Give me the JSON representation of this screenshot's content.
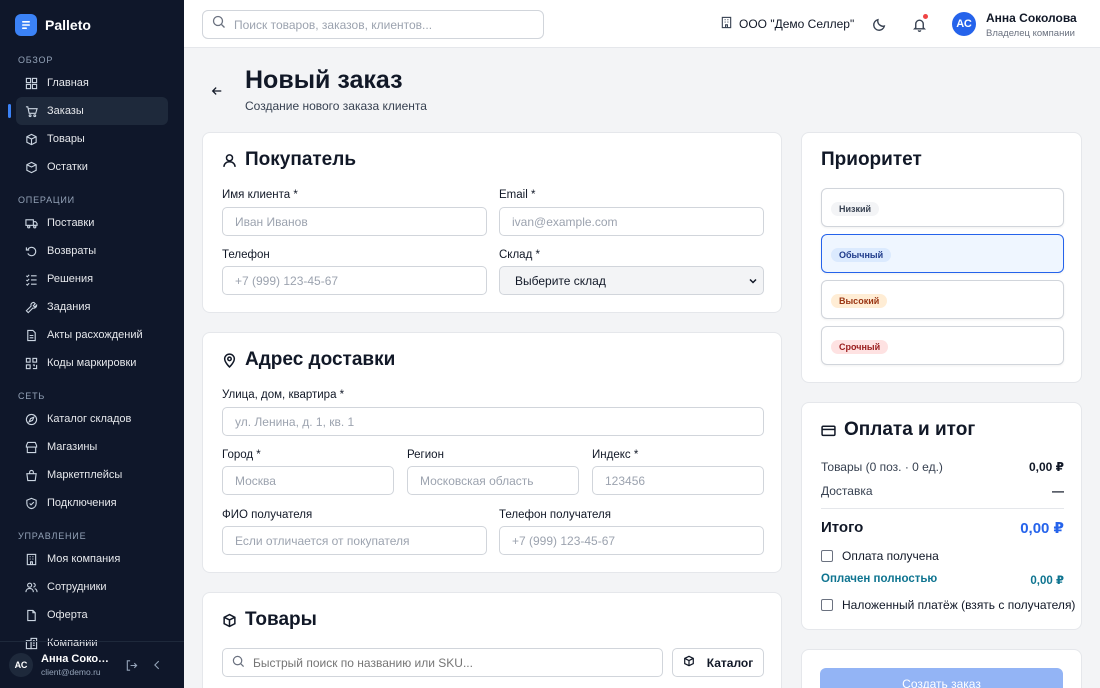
{
  "app": {
    "name": "Palleto"
  },
  "sidebar": {
    "sections": [
      {
        "title": "Обзор",
        "items": [
          {
            "label": "Главная",
            "icon": "grid-icon"
          },
          {
            "label": "Заказы",
            "icon": "cart-icon",
            "active": true
          },
          {
            "label": "Товары",
            "icon": "box-icon"
          },
          {
            "label": "Остатки",
            "icon": "stack-icon"
          }
        ]
      },
      {
        "title": "Операции",
        "items": [
          {
            "label": "Поставки",
            "icon": "truck-icon"
          },
          {
            "label": "Возвраты",
            "icon": "return-icon"
          },
          {
            "label": "Решения",
            "icon": "checklist-icon"
          },
          {
            "label": "Задания",
            "icon": "wrench-icon"
          },
          {
            "label": "Акты расхождений",
            "icon": "document-icon"
          },
          {
            "label": "Коды маркировки",
            "icon": "qr-icon"
          }
        ]
      },
      {
        "title": "Сеть",
        "items": [
          {
            "label": "Каталог складов",
            "icon": "compass-icon"
          },
          {
            "label": "Магазины",
            "icon": "store-icon"
          },
          {
            "label": "Маркетплейсы",
            "icon": "marketplace-icon"
          },
          {
            "label": "Подключения",
            "icon": "shield-icon"
          }
        ]
      },
      {
        "title": "Управление",
        "items": [
          {
            "label": "Моя компания",
            "icon": "building-icon"
          },
          {
            "label": "Сотрудники",
            "icon": "users-icon"
          },
          {
            "label": "Оферта",
            "icon": "file-icon"
          },
          {
            "label": "Компании",
            "icon": "buildings-icon"
          }
        ]
      }
    ],
    "user": {
      "initials": "АС",
      "name": "Анна Соколова",
      "email": "client@demo.ru"
    }
  },
  "topbar": {
    "search_placeholder": "Поиск товаров, заказов, клиентов...",
    "company": "ООО \"Демо Селлер\"",
    "user": {
      "initials": "АС",
      "name": "Анна Соколова",
      "role": "Владелец компании"
    }
  },
  "page": {
    "title": "Новый заказ",
    "subtitle": "Создание нового заказа клиента"
  },
  "buyer": {
    "title": "Покупатель",
    "name_label": "Имя клиента *",
    "name_placeholder": "Иван Иванов",
    "email_label": "Email *",
    "email_placeholder": "ivan@example.com",
    "phone_label": "Телефон",
    "phone_placeholder": "+7 (999) 123-45-67",
    "warehouse_label": "Склад *",
    "warehouse_value": "Выберите склад"
  },
  "address": {
    "title": "Адрес доставки",
    "street_label": "Улица, дом, квартира *",
    "street_placeholder": "ул. Ленина, д. 1, кв. 1",
    "city_label": "Город *",
    "city_placeholder": "Москва",
    "region_label": "Регион",
    "region_placeholder": "Московская область",
    "zip_label": "Индекс *",
    "zip_placeholder": "123456",
    "recipient_label": "ФИО получателя",
    "recipient_placeholder": "Если отличается от покупателя",
    "recipient_phone_label": "Телефон получателя",
    "recipient_phone_placeholder": "+7 (999) 123-45-67"
  },
  "products": {
    "title": "Товары",
    "search_placeholder": "Быстрый поиск по названию или SKU...",
    "catalog_label": "Каталог"
  },
  "priority": {
    "title": "Приоритет",
    "selected": "Обычный",
    "options": [
      {
        "label": "Низкий",
        "bg": "#f3f4f6",
        "fg": "#374151"
      },
      {
        "label": "Обычный",
        "bg": "#dbeafe",
        "fg": "#1e3a8a"
      },
      {
        "label": "Высокий",
        "bg": "#ffedd5",
        "fg": "#9a3412"
      },
      {
        "label": "Срочный",
        "bg": "#fee2e2",
        "fg": "#991b1b"
      }
    ]
  },
  "payment": {
    "title": "Оплата и итог",
    "items_label": "Товары (0 поз. · 0 ед.)",
    "items_value": "0,00 ₽",
    "delivery_label": "Доставка",
    "delivery_value": "—",
    "total_label": "Итого",
    "total_value": "0,00 ₽",
    "paid_checkbox": "Оплата получена",
    "paid_full_label": "Оплачен полностью",
    "paid_full_value": "0,00 ₽",
    "cod_checkbox": "Наложенный платёж (взять с получателя)",
    "submit_label": "Создать заказ"
  },
  "colors": {
    "accent": "#2563eb",
    "paid_status": "#0e7490",
    "sidebar_bg": "#0f172a"
  }
}
